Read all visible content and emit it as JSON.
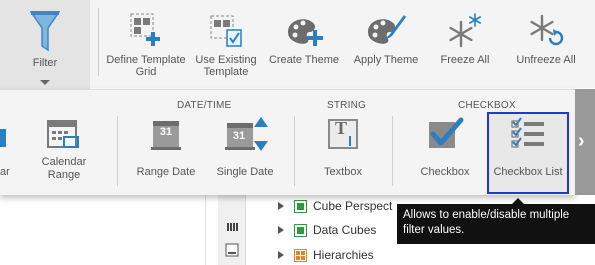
{
  "ribbon": {
    "filter_label": "Filter",
    "buttons": [
      {
        "label": "Define Template Grid",
        "icon": "define-template-grid-icon"
      },
      {
        "label": "Use Existing Template",
        "icon": "use-existing-template-icon"
      },
      {
        "label": "Create Theme",
        "icon": "create-theme-icon"
      },
      {
        "label": "Apply Theme",
        "icon": "apply-theme-icon"
      },
      {
        "label": "Freeze All",
        "icon": "freeze-all-icon"
      },
      {
        "label": "Unfreeze All",
        "icon": "unfreeze-all-icon"
      }
    ]
  },
  "filter_panel": {
    "sections": {
      "datetime": "DATE/TIME",
      "string": "STRING",
      "checkbox": "CHECKBOX"
    },
    "items": {
      "partial": "ar",
      "calendar_range": "Calendar Range",
      "range_date": "Range Date",
      "single_date": "Single Date",
      "textbox": "Textbox",
      "checkbox": "Checkbox",
      "checkbox_list": "Checkbox List"
    },
    "calendar_day": "31",
    "textbox_glyph": "T"
  },
  "tree": {
    "items": [
      "Cube Perspect",
      "Data Cubes",
      "Hierarchies"
    ]
  },
  "tooltip": {
    "text": "Allows to enable/disable multiple filter values."
  },
  "colors": {
    "accent": "#2a7fc1",
    "selection_border": "#2236d8",
    "tooltip_bg": "#111111",
    "cube_green": "#2e9a3e",
    "hierarchy_orange": "#e8812a"
  }
}
